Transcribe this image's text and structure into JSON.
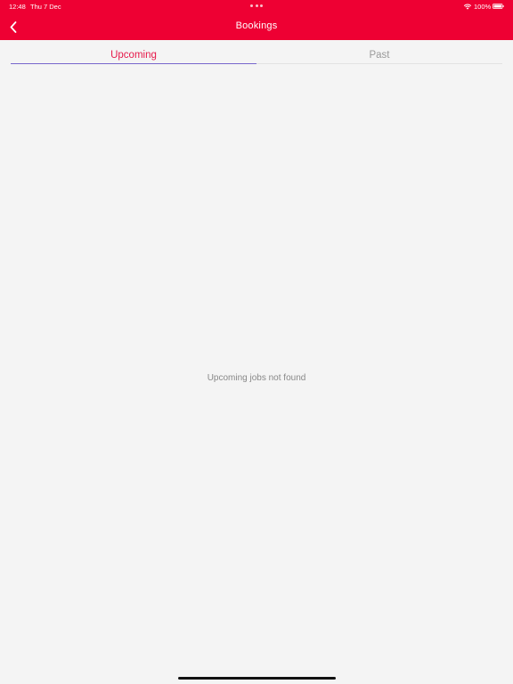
{
  "status_bar": {
    "time": "12:48",
    "date": "Thu 7 Dec",
    "battery": "100%"
  },
  "header": {
    "title": "Bookings",
    "background_color": "#ee0033"
  },
  "tabs": [
    {
      "label": "Upcoming",
      "active": true,
      "color": "#e6194a"
    },
    {
      "label": "Past",
      "active": false,
      "color": "#9a9a9a"
    }
  ],
  "content": {
    "empty_message": "Upcoming jobs not found"
  },
  "icons": {
    "back": "chevron-left-icon",
    "wifi": "wifi-icon",
    "battery": "battery-icon"
  }
}
